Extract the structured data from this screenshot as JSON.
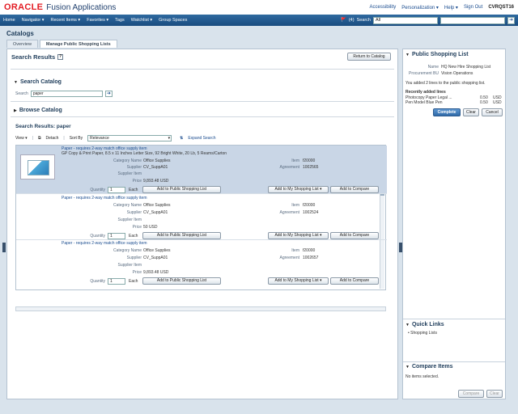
{
  "header": {
    "logo": "ORACLE",
    "product": "Fusion Applications",
    "links": [
      "Accessibility",
      "Personalization ▾",
      "Help ▾",
      "Sign Out"
    ],
    "user": "CVRQST16"
  },
  "nav": {
    "items": [
      "Home",
      "Navigator ▾",
      "Recent Items ▾",
      "Favorites ▾",
      "Tags",
      "Watchlist ▾",
      "Group Spaces"
    ],
    "notification_count": "(4)",
    "search_label": "Search",
    "search_scope": "All"
  },
  "page": {
    "title": "Catalogs",
    "tabs": [
      "Overview",
      "Manage Public Shopping Lists"
    ]
  },
  "left": {
    "results_header": "Search Results",
    "return_button": "Return to Catalog",
    "search_catalog": "Search Catalog",
    "search_label": "Search",
    "search_value": "paper",
    "browse_catalog": "Browse Catalog",
    "results_for": "Search Results: paper",
    "toolbar": {
      "view": "View ▾",
      "detach": "Detach",
      "sort_by": "Sort By",
      "sort_value": "Relevance",
      "expand_search": "Expand Search"
    },
    "items": [
      {
        "title": "Paper - requires 2-way match office supply item",
        "desc": "GP Copy & Print Paper, 8.5 x 11 Inches Letter Size, 92 Bright White, 20 Lb, 5 Reams/Carton",
        "category": "Office Supplies",
        "supplier": "CV_SuppA01",
        "supplier_item": "",
        "price": "9,893.48 USD",
        "item": "f20000",
        "agreement": "1002565",
        "qty": "1",
        "uom": "Each"
      },
      {
        "title": "Paper - requires 2-way match office supply item",
        "desc": "",
        "category": "Office Supplies",
        "supplier": "CV_SuppA01",
        "supplier_item": "",
        "price": "50 USD",
        "item": "f20000",
        "agreement": "1002524",
        "qty": "1",
        "uom": "Each"
      },
      {
        "title": "Paper - requires 2-way match office supply item",
        "desc": "",
        "category": "Office Supplies",
        "supplier": "CV_SuppA01",
        "supplier_item": "",
        "price": "9,893.48 USD",
        "item": "f20000",
        "agreement": "1002657",
        "qty": "1",
        "uom": "Each"
      }
    ],
    "labels": {
      "category": "Category Name",
      "supplier": "Supplier",
      "supplier_item": "Supplier Item",
      "price": "Price",
      "item": "Item",
      "agreement": "Agreement",
      "quantity": "Quantity",
      "add_public": "Add to Public Shopping List",
      "add_my": "Add to My Shopping List",
      "add_compare": "Add to Compare"
    }
  },
  "right": {
    "psl_title": "Public Shopping List",
    "name_label": "Name",
    "name_value": "HQ New Hire Shopping List",
    "bu_label": "Procurement BU",
    "bu_value": "Vision Operations",
    "message": "You added 2 lines to the public shopping list.",
    "recent_title": "Recently added lines",
    "recent": [
      {
        "name": "Photocopy Paper  Legal ...",
        "qty": "0.50",
        "uom": "USD"
      },
      {
        "name": "Pen Model Blue Pen",
        "qty": "0.50",
        "uom": "USD"
      }
    ],
    "buttons": {
      "complete": "Complete",
      "clear": "Clear",
      "cancel": "Cancel"
    },
    "quick_links": "Quick Links",
    "quick_link_items": [
      "Shopping Lists"
    ],
    "compare_title": "Compare Items",
    "compare_empty": "No items selected.",
    "compare_buttons": {
      "compare": "Compare",
      "clear": "Clear"
    }
  },
  "colors": {
    "brand_red": "#e31b23",
    "nav_blue": "#1a4c7f",
    "link": "#1a4c8f",
    "selected_row": "#c9d6e6"
  }
}
